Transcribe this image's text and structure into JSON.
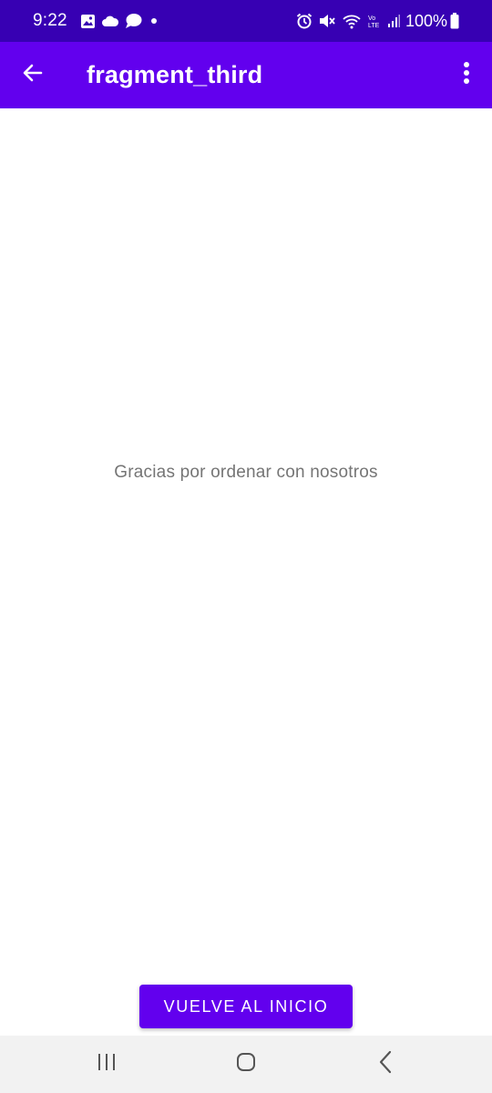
{
  "status_bar": {
    "time": "9:22",
    "battery_text": "100%",
    "left_icons": [
      "image-icon",
      "cloud-icon",
      "chat-icon",
      "dot-icon"
    ],
    "right_icons": [
      "alarm-icon",
      "mute-icon",
      "wifi-icon",
      "volte-icon",
      "signal-icon",
      "battery-icon"
    ]
  },
  "app_bar": {
    "title": "fragment_third",
    "back_icon": "arrow-back-icon",
    "overflow_icon": "more-vert-icon"
  },
  "content": {
    "message": "Gracias por ordenar con nosotros",
    "button_label": "VUELVE AL INICIO"
  },
  "nav_bar": {
    "buttons": [
      "recents-icon",
      "home-icon",
      "back-icon"
    ]
  },
  "colors": {
    "status_bar": "#3700b3",
    "app_bar": "#6200ee",
    "button": "#6200ee",
    "message_text": "#757575",
    "nav_bar": "#f2f2f2"
  }
}
